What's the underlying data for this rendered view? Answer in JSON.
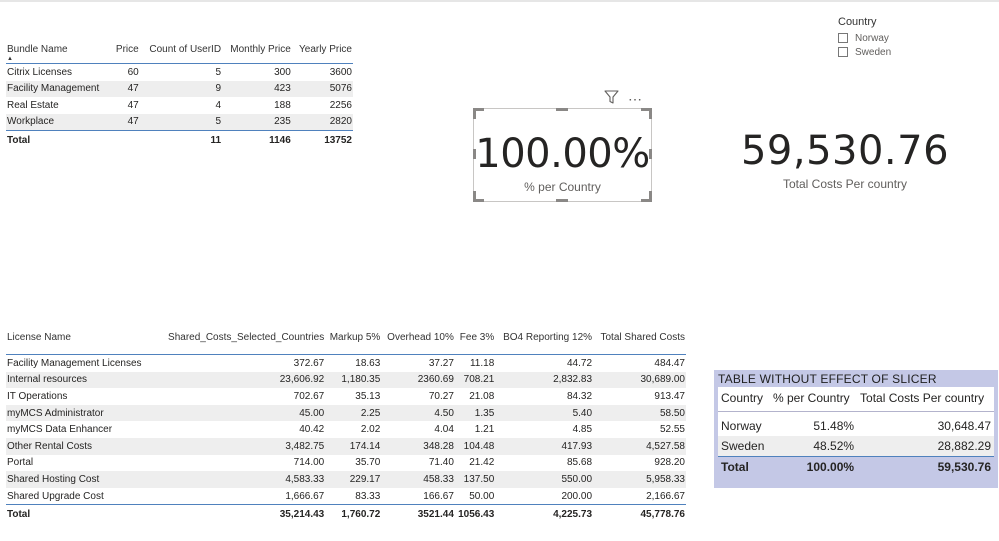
{
  "bundle_table": {
    "columns": [
      "Bundle Name",
      "Price",
      "Count of UserID",
      "Monthly Price",
      "Yearly Price"
    ],
    "rows": [
      [
        "Citrix Licenses",
        "60",
        "5",
        "300",
        "3600"
      ],
      [
        "Facility Management",
        "47",
        "9",
        "423",
        "5076"
      ],
      [
        "Real Estate",
        "47",
        "4",
        "188",
        "2256"
      ],
      [
        "Workplace",
        "47",
        "5",
        "235",
        "2820"
      ]
    ],
    "total": [
      "Total",
      "",
      "11",
      "1146",
      "13752"
    ]
  },
  "slicer": {
    "title": "Country",
    "options": [
      "Norway",
      "Sweden"
    ]
  },
  "card_percent": {
    "value": "100.00%",
    "label": "% per Country"
  },
  "card_costs": {
    "value": "59,530.76",
    "label": "Total Costs Per country"
  },
  "shared_table": {
    "columns": [
      "License Name",
      "Shared_Costs_Selected_Countries",
      "Markup 5%",
      "Overhead 10%",
      "Fee 3%",
      "BO4 Reporting 12%",
      "Total Shared Costs"
    ],
    "rows": [
      [
        "Facility Management Licenses",
        "372.67",
        "18.63",
        "37.27",
        "11.18",
        "44.72",
        "484.47"
      ],
      [
        "Internal resources",
        "23,606.92",
        "1,180.35",
        "2360.69",
        "708.21",
        "2,832.83",
        "30,689.00"
      ],
      [
        "IT Operations",
        "702.67",
        "35.13",
        "70.27",
        "21.08",
        "84.32",
        "913.47"
      ],
      [
        "myMCS Administrator",
        "45.00",
        "2.25",
        "4.50",
        "1.35",
        "5.40",
        "58.50"
      ],
      [
        "myMCS Data Enhancer",
        "40.42",
        "2.02",
        "4.04",
        "1.21",
        "4.85",
        "52.55"
      ],
      [
        "Other Rental Costs",
        "3,482.75",
        "174.14",
        "348.28",
        "104.48",
        "417.93",
        "4,527.58"
      ],
      [
        "Portal",
        "714.00",
        "35.70",
        "71.40",
        "21.42",
        "85.68",
        "928.20"
      ],
      [
        "Shared Hosting Cost",
        "4,583.33",
        "229.17",
        "458.33",
        "137.50",
        "550.00",
        "5,958.33"
      ],
      [
        "Shared Upgrade Cost",
        "1,666.67",
        "83.33",
        "166.67",
        "50.00",
        "200.00",
        "2,166.67"
      ]
    ],
    "total": [
      "Total",
      "35,214.43",
      "1,760.72",
      "3521.44",
      "1056.43",
      "4,225.73",
      "45,778.76"
    ]
  },
  "no_slicer_table": {
    "title": "TABLE WITHOUT EFFECT OF SLICER",
    "columns": [
      "Country",
      "% per Country",
      "Total Costs Per country"
    ],
    "rows": [
      [
        "Norway",
        "51.48%",
        "30,648.47"
      ],
      [
        "Sweden",
        "48.52%",
        "28,882.29"
      ]
    ],
    "total": [
      "Total",
      "100.00%",
      "59,530.76"
    ],
    "background_color": "#c4c8e6"
  },
  "colors": {
    "accent_rule": "#4f81bd",
    "banding": "#eeeeee"
  },
  "icons": [
    "filter-icon",
    "more-options-icon",
    "sort-ascending-icon",
    "checkbox-icon"
  ]
}
